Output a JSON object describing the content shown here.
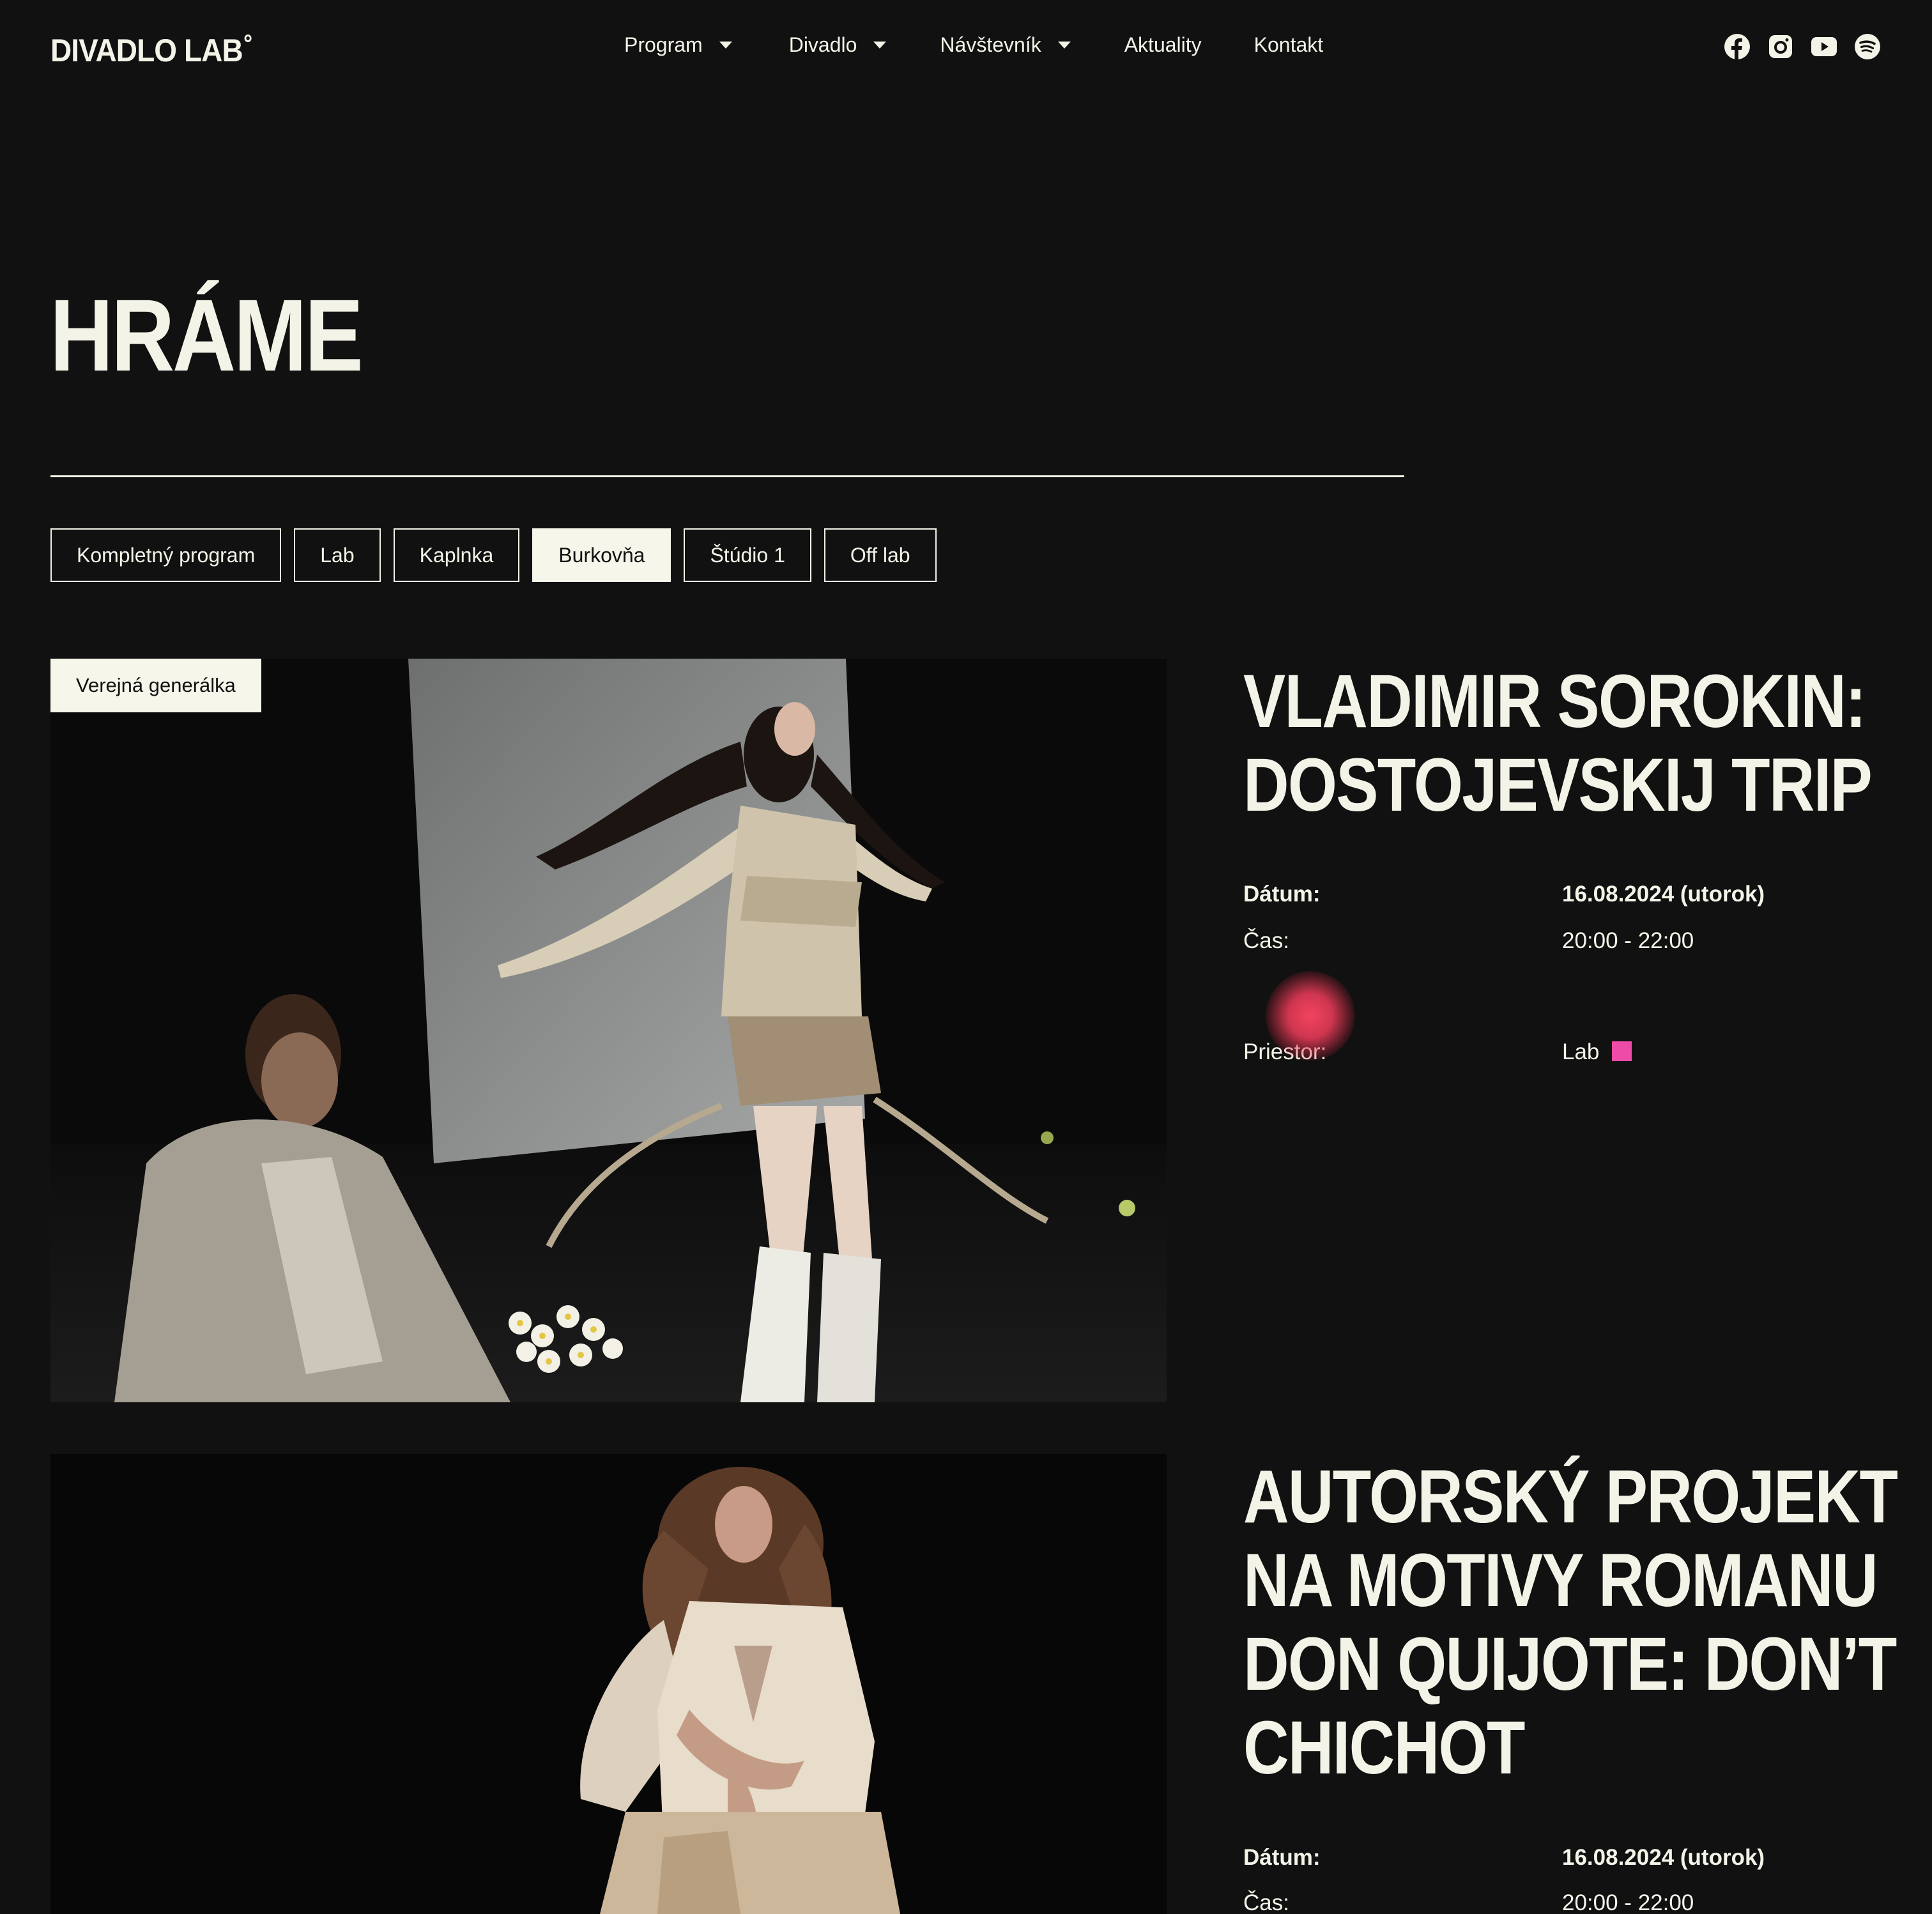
{
  "header": {
    "logo": "DIVADLO LAB",
    "nav": [
      {
        "label": "Program",
        "has_dropdown": true
      },
      {
        "label": "Divadlo",
        "has_dropdown": true
      },
      {
        "label": "Návštevník",
        "has_dropdown": true
      },
      {
        "label": "Aktuality",
        "has_dropdown": false
      },
      {
        "label": "Kontakt",
        "has_dropdown": false
      }
    ],
    "social": [
      "facebook-icon",
      "instagram-icon",
      "youtube-icon",
      "spotify-icon"
    ]
  },
  "page_title": "HRÁME",
  "filters": [
    {
      "label": "Kompletný program",
      "active": false
    },
    {
      "label": "Lab",
      "active": false
    },
    {
      "label": "Kaplnka",
      "active": false
    },
    {
      "label": "Burkovňa",
      "active": true
    },
    {
      "label": "Štúdio 1",
      "active": false
    },
    {
      "label": "Off lab",
      "active": false
    }
  ],
  "events": [
    {
      "badge": "Verejná generálka",
      "title": "VLADIMIR SOROKIN: DOSTOJEVSKIJ TRIP",
      "date_label": "Dátum:",
      "date_value": "16.08.2024 (utorok)",
      "time_label": "Čas:",
      "time_value": "20:00 - 22:00",
      "venue_label": "Priestor:",
      "venue_value": "Lab",
      "venue_color": "#ee4aa7"
    },
    {
      "title": "AUTORSKÝ PROJEKT NA MOTIVY ROMANU DON QUIJOTE: DON’T CHICHOT",
      "date_label": "Dátum:",
      "date_value": "16.08.2024 (utorok)",
      "time_label": "Čas:",
      "time_value": "20:00 - 22:00"
    }
  ],
  "colors": {
    "background": "#111111",
    "text": "#f4f3e8",
    "accent": "#ee4aa7"
  }
}
